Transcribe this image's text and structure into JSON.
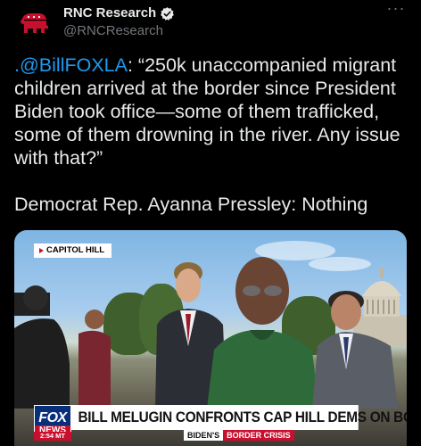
{
  "tweet": {
    "display_name": "RNC Research",
    "handle": "@RNCResearch",
    "more_label": "···",
    "mention": ".@BillFOXLA",
    "quote_rest": ": “250k unaccompanied migrant children arrived at the border since President Biden took office—some of them trafficked, some of them drowning in the river. Any issue with that?”",
    "second_paragraph": "Democrat Rep. Ayanna Pressley: Nothing"
  },
  "media": {
    "location_tag": "CAPITOL HILL",
    "network_top": "FOX",
    "network_bottom": "NEWS",
    "time": "2:54 MT",
    "headline": "BILL MELUGIN CONFRONTS CAP HILL DEMS ON BORDER",
    "show_name": "BIDEN'S",
    "show_tag": "BORDER CRISIS"
  },
  "colors": {
    "link": "#1d9bf0",
    "verified": "#e7e9ea",
    "rnc_red": "#c8102e",
    "fox_blue": "#0a2f7a"
  },
  "icons": {
    "avatar": "republican-elephant-icon",
    "verified": "verified-badge-icon",
    "more": "more-options-icon"
  }
}
